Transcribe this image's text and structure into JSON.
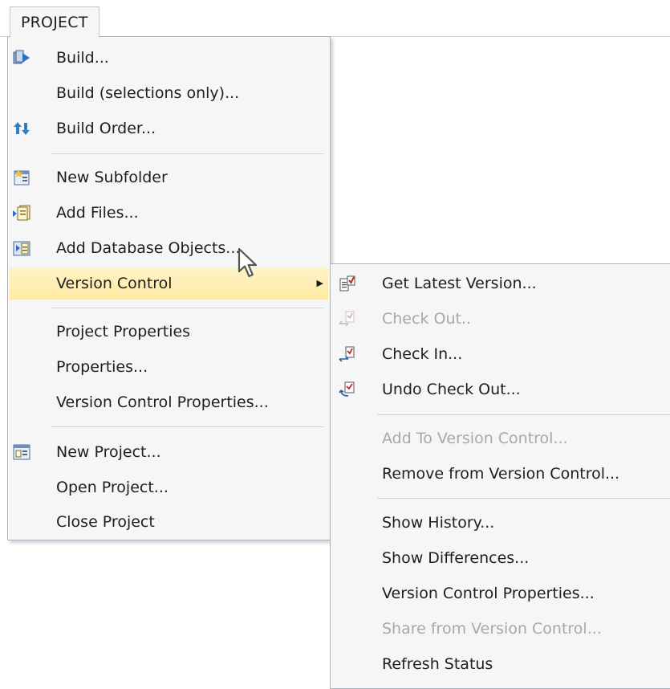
{
  "menubar": {
    "project_label": "PROJECT"
  },
  "main_menu": {
    "items": [
      {
        "label": "Build...",
        "icon": "build-icon"
      },
      {
        "label": "Build (selections only)..."
      },
      {
        "label": "Build Order...",
        "icon": "build-order-icon"
      },
      {
        "label": "New Subfolder",
        "icon": "new-subfolder-icon"
      },
      {
        "label": "Add Files...",
        "icon": "add-files-icon"
      },
      {
        "label": "Add Database Objects...",
        "icon": "add-database-objects-icon"
      },
      {
        "label": "Version Control",
        "highlighted": true,
        "submenu_arrow": "▶"
      },
      {
        "label": "Project Properties"
      },
      {
        "label": "Properties..."
      },
      {
        "label": "Version Control Properties..."
      },
      {
        "label": "New Project...",
        "icon": "new-project-icon"
      },
      {
        "label": "Open Project..."
      },
      {
        "label": "Close Project"
      }
    ]
  },
  "version_control_submenu": {
    "items": [
      {
        "label": "Get Latest Version...",
        "icon": "get-latest-version-icon"
      },
      {
        "label": "Check Out..",
        "icon": "check-out-icon",
        "disabled": true
      },
      {
        "label": "Check In...",
        "icon": "check-in-icon"
      },
      {
        "label": "Undo Check Out...",
        "icon": "undo-check-out-icon"
      },
      {
        "label": "Add To Version Control...",
        "disabled": true
      },
      {
        "label": "Remove from Version Control..."
      },
      {
        "label": "Show History..."
      },
      {
        "label": "Show Differences..."
      },
      {
        "label": "Version Control Properties..."
      },
      {
        "label": "Share from Version Control...",
        "disabled": true
      },
      {
        "label": "Refresh Status"
      }
    ]
  },
  "colors": {
    "highlight": "#ffeaa8",
    "menu_background": "#f6f6f6",
    "disabled_text": "#a8a8a8",
    "menu_border": "#a9b3c1"
  }
}
